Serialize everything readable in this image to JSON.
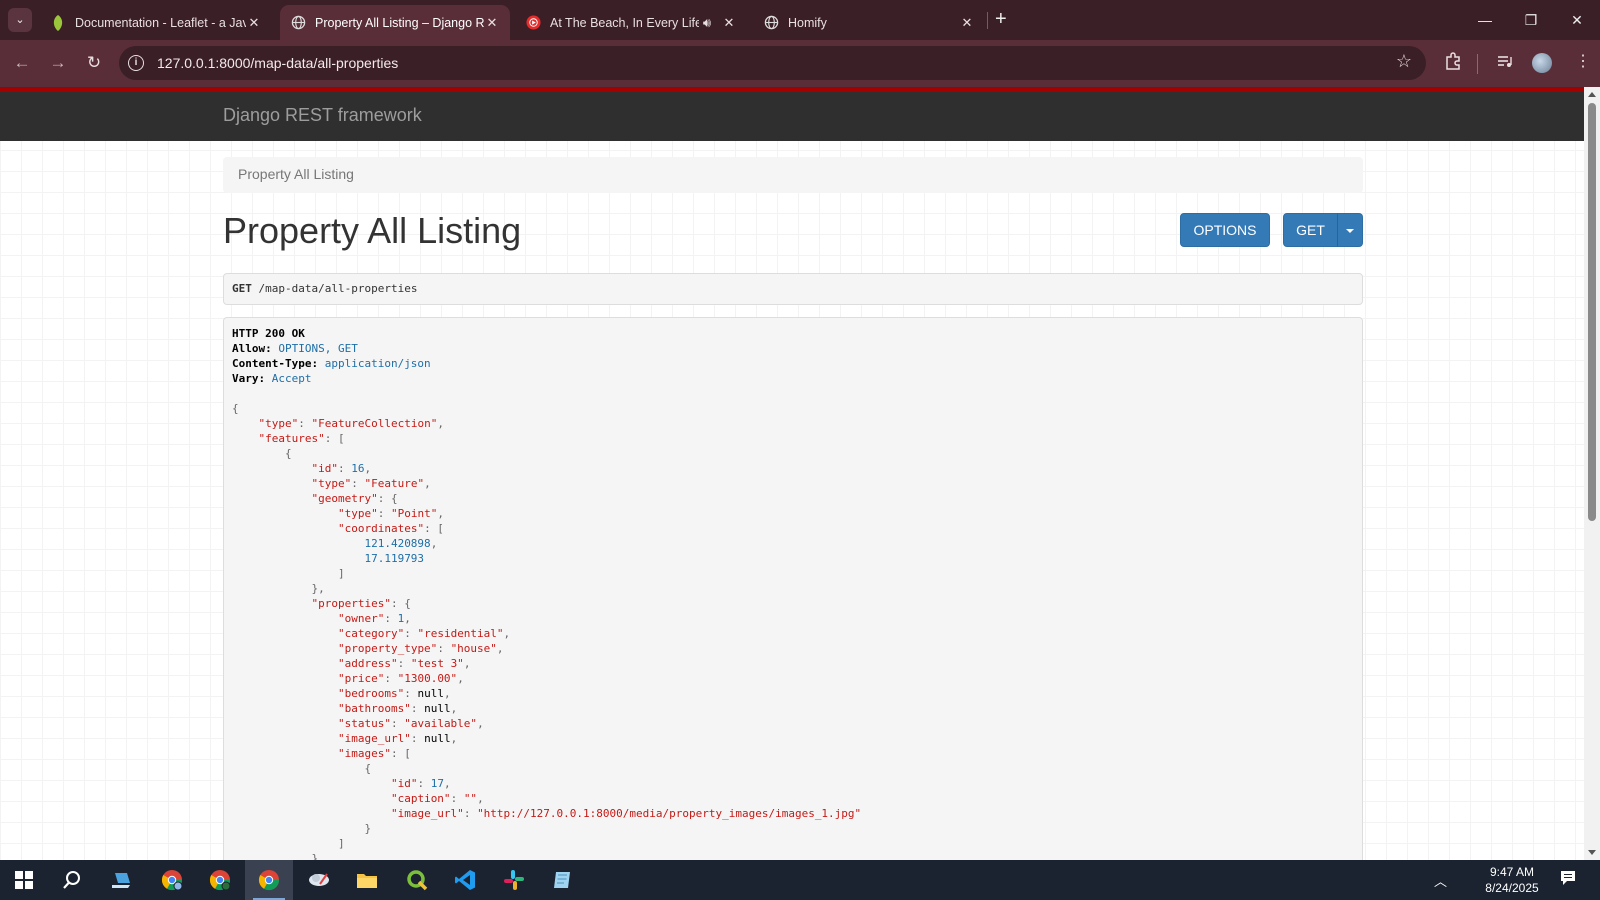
{
  "browser": {
    "tabs": [
      {
        "title": "Documentation - Leaflet - a Jav",
        "favicon": "leaf-icon",
        "color": "#9bc63b"
      },
      {
        "title": "Property All Listing – Django RE",
        "favicon": "globe-icon",
        "active": true
      },
      {
        "title": "At The Beach, In Every Life -",
        "favicon": "youtube-music-icon",
        "color": "#e62d2d",
        "audio": true
      },
      {
        "title": "Homify",
        "favicon": "globe-icon"
      }
    ],
    "url": "127.0.0.1:8000/map-data/all-properties"
  },
  "page": {
    "brand": "Django REST framework",
    "breadcrumb": "Property All Listing",
    "title": "Property All Listing",
    "options_label": "OPTIONS",
    "get_label": "GET",
    "request_method": "GET",
    "request_path": "/map-data/all-properties"
  },
  "response": {
    "status": "HTTP 200 OK",
    "headers": [
      {
        "name": "Allow:",
        "value": "OPTIONS, GET"
      },
      {
        "name": "Content-Type:",
        "value": "application/json"
      },
      {
        "name": "Vary:",
        "value": "Accept"
      }
    ],
    "body_lines": [
      {
        "indent": 0,
        "parts": [
          {
            "t": "{",
            "c": "p"
          }
        ]
      },
      {
        "indent": 1,
        "parts": [
          {
            "t": "\"type\"",
            "c": "k"
          },
          {
            "t": ": ",
            "c": "p"
          },
          {
            "t": "\"FeatureCollection\"",
            "c": "s"
          },
          {
            "t": ",",
            "c": "p"
          }
        ]
      },
      {
        "indent": 1,
        "parts": [
          {
            "t": "\"features\"",
            "c": "k"
          },
          {
            "t": ": [",
            "c": "p"
          }
        ]
      },
      {
        "indent": 2,
        "parts": [
          {
            "t": "{",
            "c": "p"
          }
        ]
      },
      {
        "indent": 3,
        "parts": [
          {
            "t": "\"id\"",
            "c": "k"
          },
          {
            "t": ": ",
            "c": "p"
          },
          {
            "t": "16",
            "c": "n"
          },
          {
            "t": ",",
            "c": "p"
          }
        ]
      },
      {
        "indent": 3,
        "parts": [
          {
            "t": "\"type\"",
            "c": "k"
          },
          {
            "t": ": ",
            "c": "p"
          },
          {
            "t": "\"Feature\"",
            "c": "s"
          },
          {
            "t": ",",
            "c": "p"
          }
        ]
      },
      {
        "indent": 3,
        "parts": [
          {
            "t": "\"geometry\"",
            "c": "k"
          },
          {
            "t": ": {",
            "c": "p"
          }
        ]
      },
      {
        "indent": 4,
        "parts": [
          {
            "t": "\"type\"",
            "c": "k"
          },
          {
            "t": ": ",
            "c": "p"
          },
          {
            "t": "\"Point\"",
            "c": "s"
          },
          {
            "t": ",",
            "c": "p"
          }
        ]
      },
      {
        "indent": 4,
        "parts": [
          {
            "t": "\"coordinates\"",
            "c": "k"
          },
          {
            "t": ": [",
            "c": "p"
          }
        ]
      },
      {
        "indent": 5,
        "parts": [
          {
            "t": "121.420898",
            "c": "n"
          },
          {
            "t": ",",
            "c": "p"
          }
        ]
      },
      {
        "indent": 5,
        "parts": [
          {
            "t": "17.119793",
            "c": "n"
          }
        ]
      },
      {
        "indent": 4,
        "parts": [
          {
            "t": "]",
            "c": "p"
          }
        ]
      },
      {
        "indent": 3,
        "parts": [
          {
            "t": "},",
            "c": "p"
          }
        ]
      },
      {
        "indent": 3,
        "parts": [
          {
            "t": "\"properties\"",
            "c": "k"
          },
          {
            "t": ": {",
            "c": "p"
          }
        ]
      },
      {
        "indent": 4,
        "parts": [
          {
            "t": "\"owner\"",
            "c": "k"
          },
          {
            "t": ": ",
            "c": "p"
          },
          {
            "t": "1",
            "c": "n"
          },
          {
            "t": ",",
            "c": "p"
          }
        ]
      },
      {
        "indent": 4,
        "parts": [
          {
            "t": "\"category\"",
            "c": "k"
          },
          {
            "t": ": ",
            "c": "p"
          },
          {
            "t": "\"residential\"",
            "c": "s"
          },
          {
            "t": ",",
            "c": "p"
          }
        ]
      },
      {
        "indent": 4,
        "parts": [
          {
            "t": "\"property_type\"",
            "c": "k"
          },
          {
            "t": ": ",
            "c": "p"
          },
          {
            "t": "\"house\"",
            "c": "s"
          },
          {
            "t": ",",
            "c": "p"
          }
        ]
      },
      {
        "indent": 4,
        "parts": [
          {
            "t": "\"address\"",
            "c": "k"
          },
          {
            "t": ": ",
            "c": "p"
          },
          {
            "t": "\"test 3\"",
            "c": "s"
          },
          {
            "t": ",",
            "c": "p"
          }
        ]
      },
      {
        "indent": 4,
        "parts": [
          {
            "t": "\"price\"",
            "c": "k"
          },
          {
            "t": ": ",
            "c": "p"
          },
          {
            "t": "\"1300.00\"",
            "c": "s"
          },
          {
            "t": ",",
            "c": "p"
          }
        ]
      },
      {
        "indent": 4,
        "parts": [
          {
            "t": "\"bedrooms\"",
            "c": "k"
          },
          {
            "t": ": ",
            "c": "p"
          },
          {
            "t": "null",
            "c": "lit"
          },
          {
            "t": ",",
            "c": "p"
          }
        ]
      },
      {
        "indent": 4,
        "parts": [
          {
            "t": "\"bathrooms\"",
            "c": "k"
          },
          {
            "t": ": ",
            "c": "p"
          },
          {
            "t": "null",
            "c": "lit"
          },
          {
            "t": ",",
            "c": "p"
          }
        ]
      },
      {
        "indent": 4,
        "parts": [
          {
            "t": "\"status\"",
            "c": "k"
          },
          {
            "t": ": ",
            "c": "p"
          },
          {
            "t": "\"available\"",
            "c": "s"
          },
          {
            "t": ",",
            "c": "p"
          }
        ]
      },
      {
        "indent": 4,
        "parts": [
          {
            "t": "\"image_url\"",
            "c": "k"
          },
          {
            "t": ": ",
            "c": "p"
          },
          {
            "t": "null",
            "c": "lit"
          },
          {
            "t": ",",
            "c": "p"
          }
        ]
      },
      {
        "indent": 4,
        "parts": [
          {
            "t": "\"images\"",
            "c": "k"
          },
          {
            "t": ": [",
            "c": "p"
          }
        ]
      },
      {
        "indent": 5,
        "parts": [
          {
            "t": "{",
            "c": "p"
          }
        ]
      },
      {
        "indent": 6,
        "parts": [
          {
            "t": "\"id\"",
            "c": "k"
          },
          {
            "t": ": ",
            "c": "p"
          },
          {
            "t": "17",
            "c": "n"
          },
          {
            "t": ",",
            "c": "p"
          }
        ]
      },
      {
        "indent": 6,
        "parts": [
          {
            "t": "\"caption\"",
            "c": "k"
          },
          {
            "t": ": ",
            "c": "p"
          },
          {
            "t": "\"\"",
            "c": "s"
          },
          {
            "t": ",",
            "c": "p"
          }
        ]
      },
      {
        "indent": 6,
        "parts": [
          {
            "t": "\"image_url\"",
            "c": "k"
          },
          {
            "t": ": ",
            "c": "p"
          },
          {
            "t": "\"http://127.0.0.1:8000/media/property_images/images_1.jpg\"",
            "c": "s"
          }
        ]
      },
      {
        "indent": 5,
        "parts": [
          {
            "t": "}",
            "c": "p"
          }
        ]
      },
      {
        "indent": 4,
        "parts": [
          {
            "t": "]",
            "c": "p"
          }
        ]
      },
      {
        "indent": 3,
        "parts": [
          {
            "t": "}",
            "c": "p"
          }
        ]
      }
    ]
  },
  "taskbar": {
    "apps": [
      "windows-start-icon",
      "search-icon",
      "laptop-app-icon",
      "chrome-profile-icon",
      "chrome-profile-icon",
      "chrome-icon",
      "cloud-app-icon",
      "file-explorer-icon",
      "qgis-icon",
      "vscode-icon",
      "slack-icon",
      "notes-app-icon"
    ],
    "time": "9:47 AM",
    "date": "8/24/2025"
  }
}
